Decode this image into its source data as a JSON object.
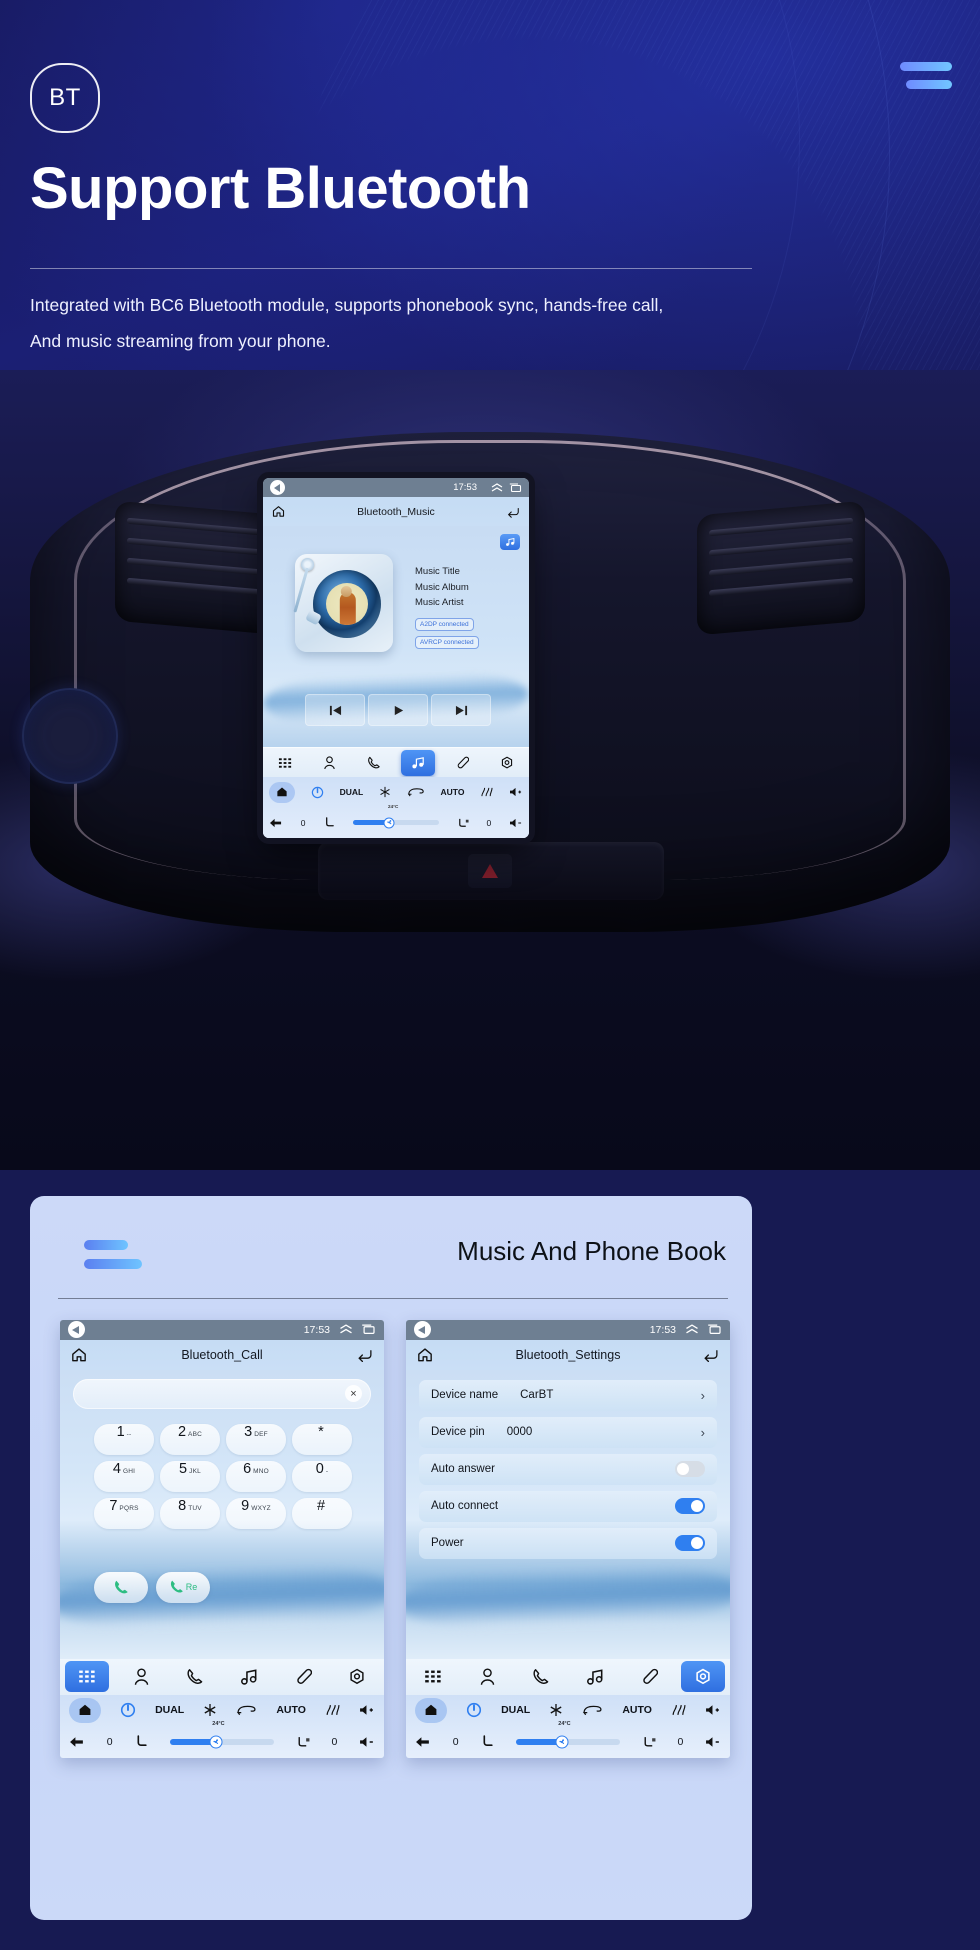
{
  "hero": {
    "badge": "BT",
    "title": "Support Bluetooth",
    "subtitle_line1": "Integrated with BC6 Bluetooth module, supports phonebook sync, hands-free call,",
    "subtitle_line2": "And music streaming from your phone.",
    "accent": "#6f8bff"
  },
  "main_unit": {
    "status": {
      "time": "17:53",
      "back_icon": "back-arrow-icon",
      "up_icon": "chevron-up-icon",
      "recents_icon": "recents-icon"
    },
    "title": "Bluetooth_Music",
    "home_icon": "home-icon",
    "return_icon": "return-arrow-icon",
    "music_badge_icon": "music-note-icon",
    "meta": {
      "title": "Music Title",
      "album": "Music Album",
      "artist": "Music Artist",
      "chip_a2dp": "A2DP  connected",
      "chip_avrcp": "AVRCP connected"
    },
    "transport": [
      "prev-track-icon",
      "play-icon",
      "next-track-icon"
    ],
    "dock": [
      {
        "name": "apps-grid-icon",
        "active": false
      },
      {
        "name": "contacts-icon",
        "active": false
      },
      {
        "name": "phone-icon",
        "active": false
      },
      {
        "name": "music-note-icon",
        "active": true
      },
      {
        "name": "link-icon",
        "active": false
      },
      {
        "name": "settings-gear-icon",
        "active": false
      }
    ],
    "climate": {
      "home_icon": "home-icon",
      "power_icon": "power-icon",
      "dual_label": "DUAL",
      "snow_icon": "snowflake-icon",
      "recirc_icon": "recirculation-icon",
      "auto_label": "AUTO",
      "defrost_icon": "defrost-icon",
      "vol_up_icon": "volume-up-icon",
      "temp": "24°C",
      "back_icon": "back-arrow-icon",
      "left_value": "0",
      "seat_icon": "seat-icon",
      "fan_icon": "fan-icon",
      "seat_heat_icon": "seat-heat-icon",
      "right_value": "0",
      "vol_down_icon": "volume-down-icon",
      "fan_percent": 45
    }
  },
  "card": {
    "title": "Music And Phone Book",
    "left_screen": {
      "status": {
        "time": "17:53"
      },
      "title": "Bluetooth_Call",
      "home_icon": "home-icon",
      "return_icon": "return-arrow-icon",
      "search_value": "",
      "search_clear_icon": "clear-x-icon",
      "keys": [
        {
          "num": "1",
          "sub": "--"
        },
        {
          "num": "2",
          "sub": "ABC"
        },
        {
          "num": "3",
          "sub": "DEF"
        },
        {
          "num": "*",
          "sub": ""
        },
        {
          "num": "4",
          "sub": "GHI"
        },
        {
          "num": "5",
          "sub": "JKL"
        },
        {
          "num": "6",
          "sub": "MNO"
        },
        {
          "num": "0",
          "sub": "-"
        },
        {
          "num": "7",
          "sub": "PQRS"
        },
        {
          "num": "8",
          "sub": "TUV"
        },
        {
          "num": "9",
          "sub": "WXYZ"
        },
        {
          "num": "#",
          "sub": ""
        }
      ],
      "call_button_icon": "phone-call-icon",
      "redial_button_icon": "phone-redial-icon",
      "redial_label": "Re",
      "dock": [
        {
          "name": "apps-grid-icon",
          "active": true
        },
        {
          "name": "contacts-icon",
          "active": false
        },
        {
          "name": "phone-icon",
          "active": false
        },
        {
          "name": "music-note-icon",
          "active": false
        },
        {
          "name": "link-icon",
          "active": false
        },
        {
          "name": "settings-gear-icon",
          "active": false
        }
      ],
      "climate": {
        "dual_label": "DUAL",
        "auto_label": "AUTO",
        "temp": "24°C",
        "left_value": "0",
        "right_value": "0",
        "fan_percent": 46
      }
    },
    "right_screen": {
      "status": {
        "time": "17:53"
      },
      "title": "Bluetooth_Settings",
      "home_icon": "home-icon",
      "return_icon": "return-arrow-icon",
      "settings": [
        {
          "label": "Device name",
          "value": "CarBT",
          "control": "chevron"
        },
        {
          "label": "Device pin",
          "value": "0000",
          "control": "chevron"
        },
        {
          "label": "Auto answer",
          "value": "",
          "control": "toggle",
          "on": false
        },
        {
          "label": "Auto connect",
          "value": "",
          "control": "toggle",
          "on": true
        },
        {
          "label": "Power",
          "value": "",
          "control": "toggle",
          "on": true
        }
      ],
      "dock": [
        {
          "name": "apps-grid-icon",
          "active": false
        },
        {
          "name": "contacts-icon",
          "active": false
        },
        {
          "name": "phone-icon",
          "active": false
        },
        {
          "name": "music-note-icon",
          "active": false
        },
        {
          "name": "link-icon",
          "active": false
        },
        {
          "name": "settings-gear-icon",
          "active": true
        }
      ],
      "climate": {
        "dual_label": "DUAL",
        "auto_label": "AUTO",
        "temp": "24°C",
        "left_value": "0",
        "right_value": "0",
        "fan_percent": 46
      }
    }
  }
}
